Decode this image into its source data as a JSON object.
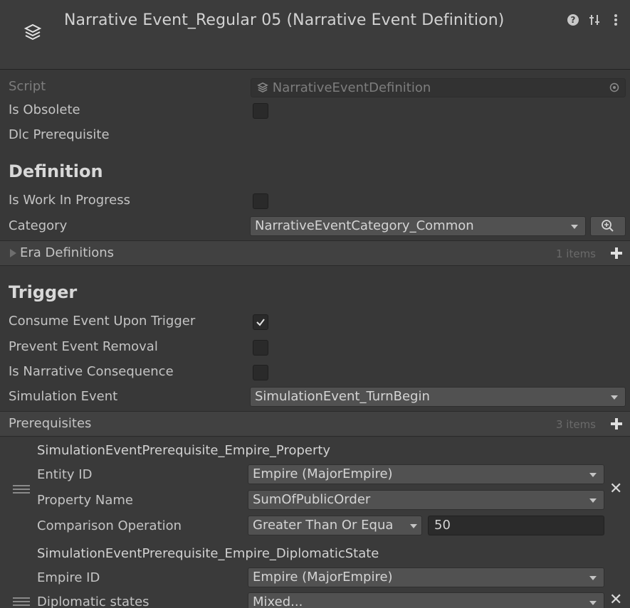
{
  "header": {
    "title": "Narrative Event_Regular 05 (Narrative Event Definition)",
    "icons": [
      "scriptable-object-icon",
      "help-icon",
      "preset-icon",
      "more-menu-icon"
    ]
  },
  "script": {
    "label": "Script",
    "value": "NarrativeEventDefinition"
  },
  "is_obsolete": {
    "label": "Is Obsolete",
    "checked": false
  },
  "dlc_prerequisite": {
    "label": "Dlc Prerequisite"
  },
  "definition": {
    "heading": "Definition",
    "is_wip": {
      "label": "Is Work In Progress",
      "checked": false
    },
    "category": {
      "label": "Category",
      "value": "NarrativeEventCategory_Common"
    },
    "era_definitions": {
      "label": "Era Definitions",
      "count": "1 items"
    }
  },
  "trigger": {
    "heading": "Trigger",
    "consume": {
      "label": "Consume Event Upon Trigger",
      "checked": true
    },
    "prevent_removal": {
      "label": "Prevent Event Removal",
      "checked": false
    },
    "is_consequence": {
      "label": "Is Narrative Consequence",
      "checked": false
    },
    "simulation_event": {
      "label": "Simulation Event",
      "value": "SimulationEvent_TurnBegin"
    }
  },
  "prerequisites": {
    "label": "Prerequisites",
    "count": "3 items",
    "items": [
      {
        "title": "SimulationEventPrerequisite_Empire_Property",
        "entity_label": "Entity ID",
        "entity_value": "Empire (MajorEmpire)",
        "property_label": "Property Name",
        "property_value": "SumOfPublicOrder",
        "comparison_label": "Comparison Operation",
        "comparison_value": "Greater Than Or Equa",
        "threshold": "50"
      },
      {
        "title": "SimulationEventPrerequisite_Empire_DiplomaticState",
        "empire_label": "Empire ID",
        "empire_value": "Empire (MajorEmpire)",
        "states_label": "Diplomatic states",
        "states_value": "Mixed..."
      }
    ]
  },
  "colors": {
    "background": "#383838",
    "field": "#2b2b2b",
    "dropdown": "#515151",
    "bar": "#414141"
  }
}
